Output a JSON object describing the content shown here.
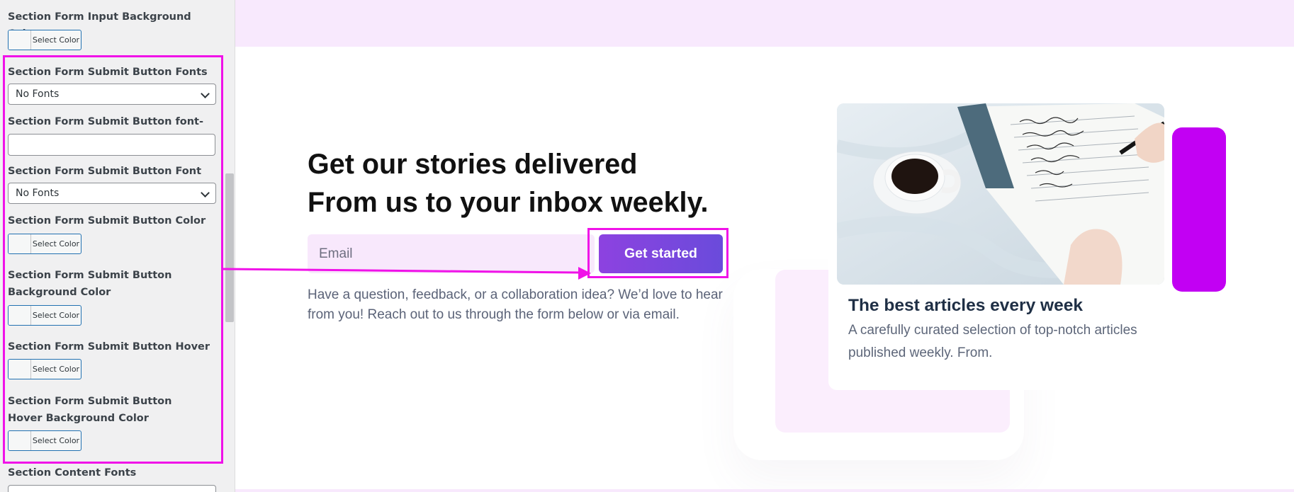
{
  "panel": {
    "settings": [
      {
        "label": "Section Form Input Background Color",
        "type": "color",
        "button": "Select Color"
      },
      {
        "label": "Section Form Submit Button Fonts",
        "type": "select",
        "value": "No Fonts"
      },
      {
        "label": "Section Form Submit Button font-size in px",
        "type": "text",
        "value": ""
      },
      {
        "label": "Section Form Submit Button Font Weight",
        "type": "select",
        "value": "No Fonts"
      },
      {
        "label": "Section Form Submit Button Color",
        "type": "color",
        "button": "Select Color"
      },
      {
        "label": "Section Form Submit Button Background Color",
        "type": "color",
        "button": "Select Color"
      },
      {
        "label": "Section Form Submit Button Hover Color",
        "type": "color",
        "button": "Select Color"
      },
      {
        "label": "Section Form Submit Button Hover Background Color",
        "type": "color",
        "button": "Select Color"
      },
      {
        "label": "Section Content Fonts",
        "type": "select",
        "value": ""
      }
    ],
    "highlight_color": "#f012e8"
  },
  "preview": {
    "headline_line1": "Get our stories delivered",
    "headline_line2": "From us to your inbox weekly.",
    "email_placeholder": "Email",
    "cta_label": "Get started",
    "description": "Have a question, feedback, or a collaboration idea? We’d love to hear from you! Reach out to us through the form below or via email.",
    "card": {
      "image_icon": "coffee-and-notebook-image",
      "title": "The best articles every week",
      "text": "A carefully curated selection of top-notch articles published weekly. From."
    },
    "colors": {
      "accent": "#c200f3",
      "cta_start": "#8d42e0",
      "cta_end": "#6a4bdb",
      "band": "#f8e9fd"
    }
  }
}
